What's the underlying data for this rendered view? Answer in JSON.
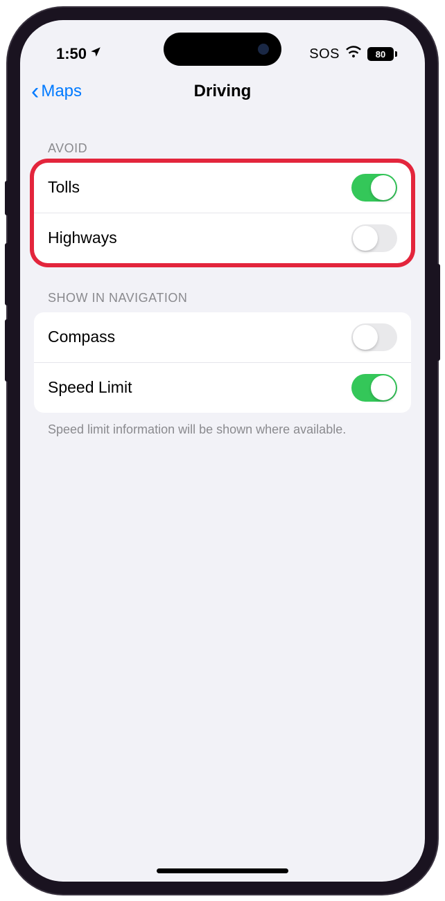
{
  "status": {
    "time": "1:50",
    "sos": "SOS",
    "battery_level": "80"
  },
  "nav": {
    "back_label": "Maps",
    "title": "Driving"
  },
  "sections": {
    "avoid": {
      "header": "AVOID",
      "tolls": {
        "label": "Tolls",
        "on": true
      },
      "highways": {
        "label": "Highways",
        "on": false
      }
    },
    "show_nav": {
      "header": "SHOW IN NAVIGATION",
      "compass": {
        "label": "Compass",
        "on": false
      },
      "speed_limit": {
        "label": "Speed Limit",
        "on": true
      },
      "footer": "Speed limit information will be shown where available."
    }
  },
  "colors": {
    "accent_blue": "#007aff",
    "toggle_green": "#34c759",
    "highlight_red": "#e3253c",
    "background": "#f2f2f7"
  }
}
